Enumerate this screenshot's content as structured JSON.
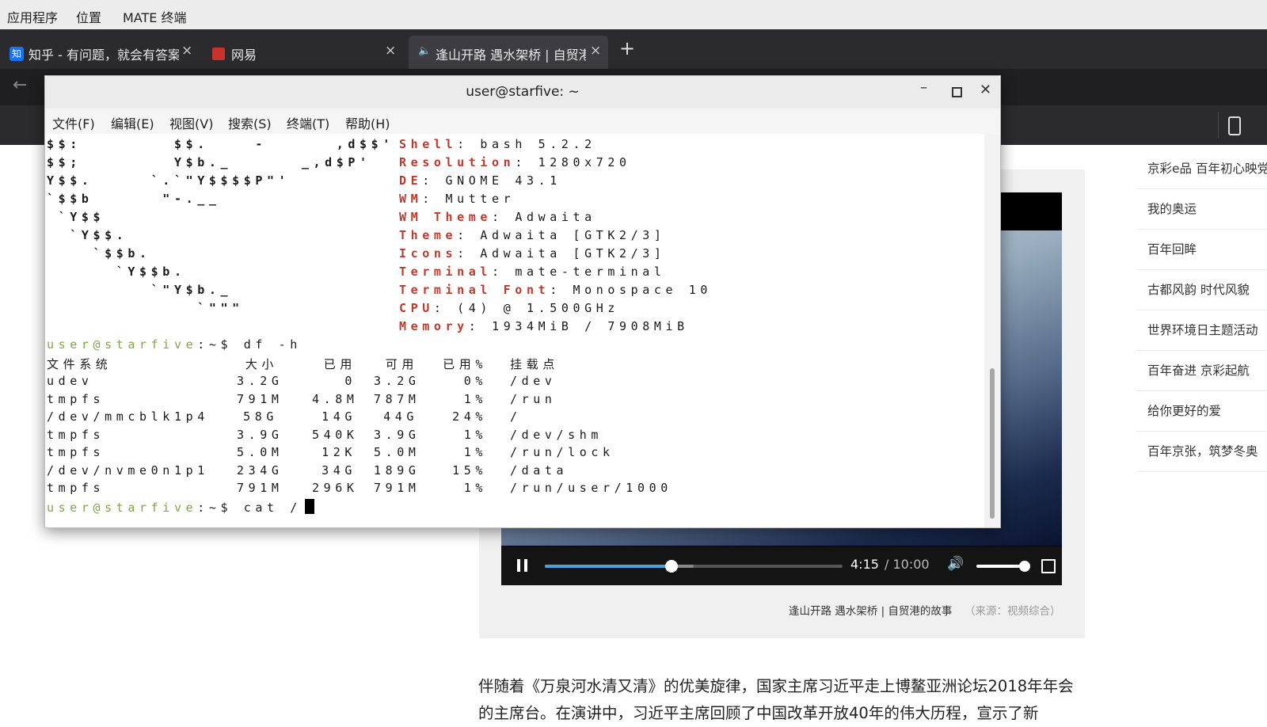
{
  "system_panel": {
    "applications": "应用程序",
    "places": "位置",
    "app_name": "MATE 终端"
  },
  "browser": {
    "tabs": [
      {
        "favicon": "知",
        "label": "知乎 - 有问题，就会有答案",
        "close": "×"
      },
      {
        "favicon": "",
        "label": "网易",
        "close": "×"
      },
      {
        "favicon": "speaker-icon",
        "label": "逢山开路 遇水架桥 | 自贸港",
        "close": "×"
      }
    ],
    "new_tab": "+"
  },
  "terminal": {
    "title": "user@starfive: ~",
    "menu": [
      "文件(F)",
      "编辑(E)",
      "视图(V)",
      "搜索(S)",
      "终端(T)",
      "帮助(H)"
    ],
    "logo_lines": [
      "$$:        $$.    -      ,d$$'",
      "$$;        Y$b._      _,d$P'",
      "Y$$.     `.`\"Y$$$$P\"'",
      "`$$b      \"-.__",
      " `Y$$",
      "  `Y$$.",
      "    `$$b.",
      "      `Y$$b.",
      "         `\"Y$b._",
      "             `\"\"\""
    ],
    "info": [
      {
        "key": "Shell",
        "value": "bash 5.2.2"
      },
      {
        "key": "Resolution",
        "value": "1280x720"
      },
      {
        "key": "DE",
        "value": "GNOME 43.1"
      },
      {
        "key": "WM",
        "value": "Mutter"
      },
      {
        "key": "WM Theme",
        "value": "Adwaita"
      },
      {
        "key": "Theme",
        "value": "Adwaita [GTK2/3]"
      },
      {
        "key": "Icons",
        "value": "Adwaita [GTK2/3]"
      },
      {
        "key": "Terminal",
        "value": "mate-terminal"
      },
      {
        "key": "Terminal Font",
        "value": "Monospace 10"
      },
      {
        "key": "CPU",
        "value": "(4) @ 1.500GHz"
      },
      {
        "key": "Memory",
        "value": "1934MiB / 7908MiB"
      }
    ],
    "prompt_user": "user@starfive",
    "prompt_path": ":~$",
    "command1": "df -h",
    "df_header": [
      "文件系统",
      "大小",
      "已用",
      "可用",
      "已用%",
      "挂载点"
    ],
    "df_rows": [
      [
        "udev",
        "3.2G",
        "0",
        "3.2G",
        "0%",
        "/dev"
      ],
      [
        "tmpfs",
        "791M",
        "4.8M",
        "787M",
        "1%",
        "/run"
      ],
      [
        "/dev/mmcblk1p4",
        "58G",
        "14G",
        "44G",
        "24%",
        "/"
      ],
      [
        "tmpfs",
        "3.9G",
        "540K",
        "3.9G",
        "1%",
        "/dev/shm"
      ],
      [
        "tmpfs",
        "5.0M",
        "12K",
        "5.0M",
        "1%",
        "/run/lock"
      ],
      [
        "/dev/nvme0n1p1",
        "234G",
        "34G",
        "189G",
        "15%",
        "/data"
      ],
      [
        "tmpfs",
        "791M",
        "296K",
        "791M",
        "1%",
        "/run/user/1000"
      ]
    ],
    "command2": "cat /"
  },
  "video": {
    "time_current": "4:15",
    "time_total": "/ 10:00",
    "progress_fraction": 0.425,
    "volume_fraction": 0.95,
    "caption": "逢山开路 遇水架桥 | 自贸港的故事",
    "source": "（来源：视频综合）"
  },
  "sidebar": {
    "items": [
      "京彩e品 百年初心映党旗",
      "我的奥运",
      "百年回眸",
      "古都风韵 时代风貌",
      "世界环境日主题活动",
      "百年奋进 京彩起航",
      "给你更好的爱",
      "百年京张，筑梦冬奥"
    ]
  },
  "article": {
    "text": "伴随着《万泉河水清又清》的优美旋律，国家主席习近平走上博鳌亚洲论坛2018年年会的主席台。在演讲中，习近平主席回顾了中国改革开放40年的伟大历程，宣示了新"
  },
  "colors": {
    "terminal_key": "#c0392b",
    "prompt_green": "#7fa845",
    "video_progress": "#4aa3df"
  }
}
